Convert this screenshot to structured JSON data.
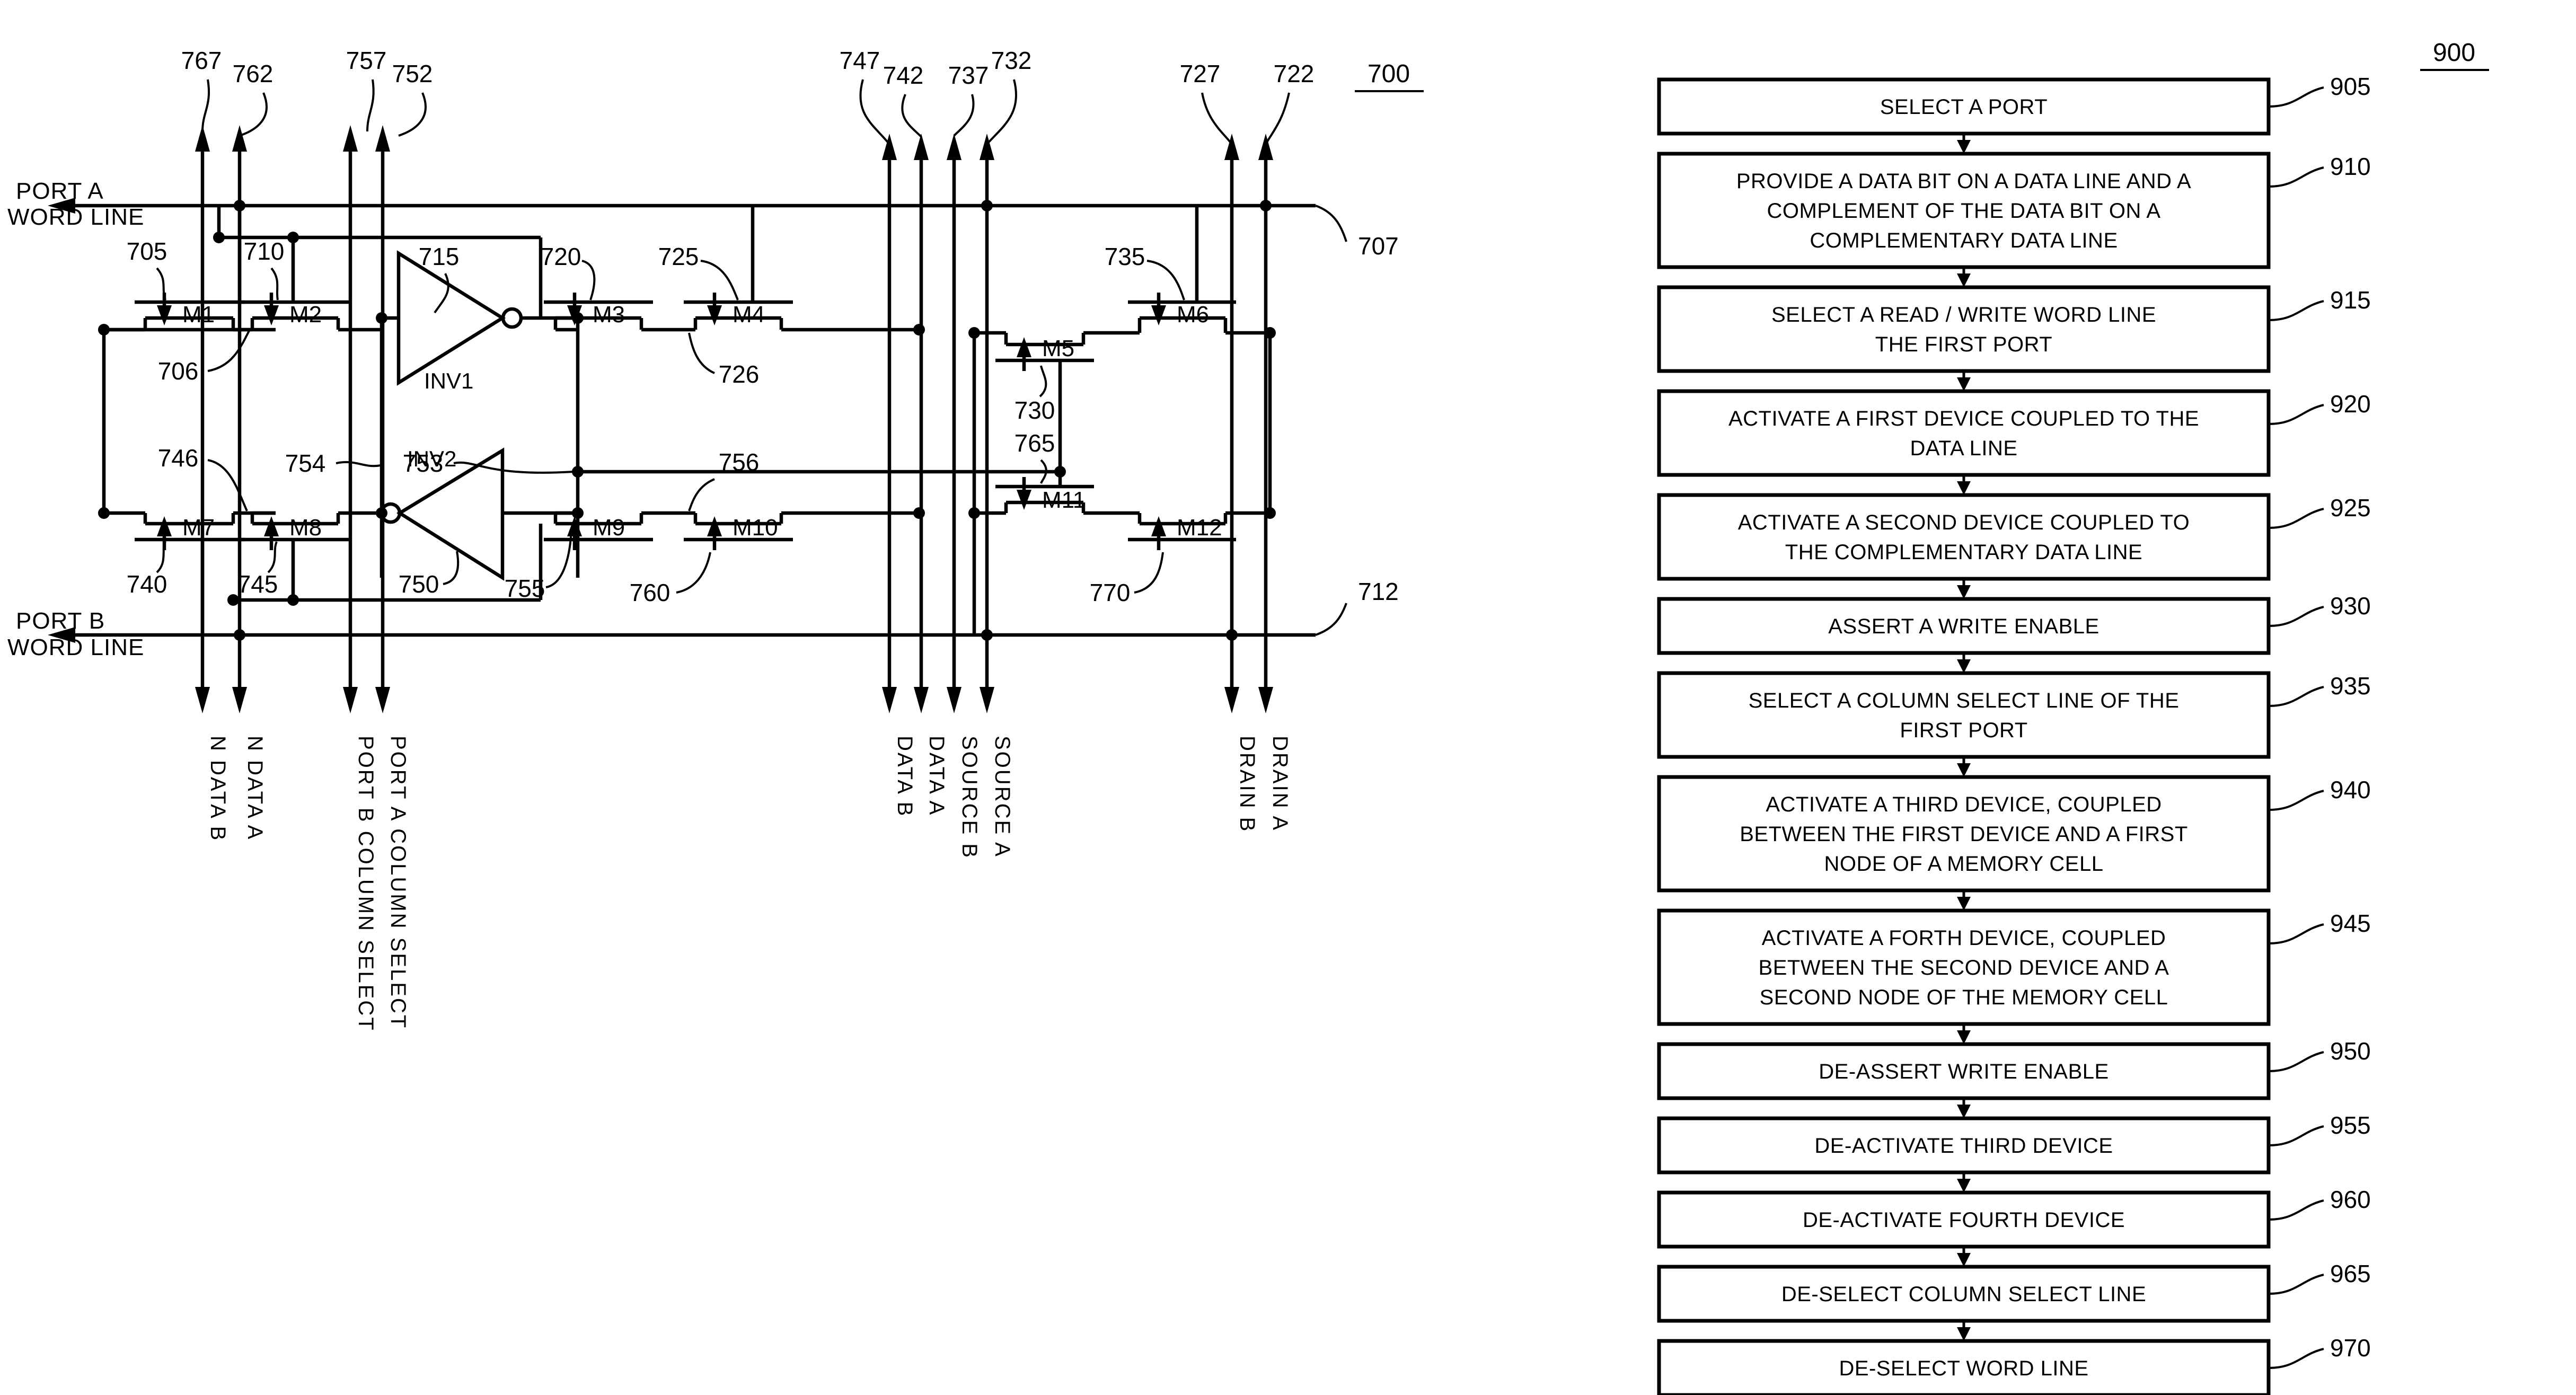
{
  "figures": {
    "circuit": {
      "fig_number": "700",
      "port_labels": {
        "port_a_word_line": "PORT A\nWORD LINE",
        "port_a_word_line_l1": "PORT A",
        "port_a_word_line_l2": "WORD LINE",
        "port_b_word_line_l1": "PORT B",
        "port_b_word_line_l2": "WORD LINE"
      },
      "transistors": [
        {
          "id": "M1",
          "label": "M1"
        },
        {
          "id": "M2",
          "label": "M2"
        },
        {
          "id": "M3",
          "label": "M3"
        },
        {
          "id": "M4",
          "label": "M4"
        },
        {
          "id": "M5",
          "label": "M5"
        },
        {
          "id": "M6",
          "label": "M6"
        },
        {
          "id": "M7",
          "label": "M7"
        },
        {
          "id": "M8",
          "label": "M8"
        },
        {
          "id": "M9",
          "label": "M9"
        },
        {
          "id": "M10",
          "label": "M10"
        },
        {
          "id": "M11",
          "label": "M11"
        },
        {
          "id": "M12",
          "label": "M12"
        }
      ],
      "inverters": [
        {
          "id": "INV1",
          "label": "INV1"
        },
        {
          "id": "INV2",
          "label": "INV2"
        }
      ],
      "reference_numerals": {
        "top": [
          "767",
          "762",
          "757",
          "752",
          "747",
          "742",
          "737",
          "732",
          "727",
          "722"
        ],
        "inner": [
          "705",
          "706",
          "710",
          "715",
          "720",
          "725",
          "726",
          "735",
          "730",
          "765",
          "753",
          "754",
          "746",
          "740",
          "745",
          "750",
          "755",
          "756",
          "760",
          "770"
        ],
        "right": [
          "707",
          "712"
        ]
      },
      "top_refs": [
        {
          "label": "767"
        },
        {
          "label": "762"
        },
        {
          "label": "757"
        },
        {
          "label": "752"
        },
        {
          "label": "747"
        },
        {
          "label": "742"
        },
        {
          "label": "737"
        },
        {
          "label": "732"
        },
        {
          "label": "727"
        },
        {
          "label": "722"
        }
      ],
      "bottom_labels": [
        {
          "text": "N DATA  B"
        },
        {
          "text": "N DATA  A"
        },
        {
          "text": "PORT B  COLUMN SELECT"
        },
        {
          "text": "PORT A  COLUMN SELECT"
        },
        {
          "text": "DATA  B"
        },
        {
          "text": "DATA  A"
        },
        {
          "text": "SOURCE  B"
        },
        {
          "text": "SOURCE  A"
        },
        {
          "text": "DRAIN  B"
        },
        {
          "text": "DRAIN  A"
        }
      ],
      "bus_refs": {
        "top_bus": "707",
        "bottom_bus": "712"
      }
    },
    "flowchart": {
      "fig_number": "900",
      "steps": [
        {
          "ref": "905",
          "text": "SELECT A PORT",
          "lines": [
            "SELECT A PORT"
          ]
        },
        {
          "ref": "910",
          "text": "PROVIDE A DATA BIT ON A DATA LINE AND A COMPLEMENT OF THE DATA BIT ON A COMPLEMENTARY DATA LINE",
          "lines": [
            "PROVIDE A DATA BIT ON A DATA LINE AND A",
            "COMPLEMENT OF THE DATA BIT ON A",
            "COMPLEMENTARY DATA LINE"
          ]
        },
        {
          "ref": "915",
          "text": "SELECT A READ / WRITE WORD LINE THE FIRST PORT",
          "lines": [
            "SELECT A READ / WRITE WORD LINE",
            "THE FIRST PORT"
          ]
        },
        {
          "ref": "920",
          "text": "ACTIVATE A FIRST DEVICE COUPLED TO THE DATA LINE",
          "lines": [
            "ACTIVATE A FIRST DEVICE COUPLED TO THE",
            "DATA LINE"
          ]
        },
        {
          "ref": "925",
          "text": "ACTIVATE A SECOND DEVICE COUPLED TO THE COMPLEMENTARY DATA LINE",
          "lines": [
            "ACTIVATE A SECOND DEVICE COUPLED TO",
            "THE COMPLEMENTARY DATA LINE"
          ]
        },
        {
          "ref": "930",
          "text": "ASSERT A WRITE ENABLE",
          "lines": [
            "ASSERT A WRITE ENABLE"
          ]
        },
        {
          "ref": "935",
          "text": "SELECT A COLUMN SELECT LINE OF THE FIRST PORT",
          "lines": [
            "SELECT A COLUMN SELECT LINE OF THE",
            "FIRST PORT"
          ]
        },
        {
          "ref": "940",
          "text": "ACTIVATE A THIRD DEVICE, COUPLED BETWEEN THE FIRST DEVICE AND A FIRST NODE OF A MEMORY CELL",
          "lines": [
            "ACTIVATE A THIRD DEVICE, COUPLED",
            "BETWEEN THE FIRST DEVICE AND A FIRST",
            "NODE OF A MEMORY CELL"
          ]
        },
        {
          "ref": "945",
          "text": "ACTIVATE A FORTH DEVICE, COUPLED BETWEEN THE SECOND DEVICE AND A SECOND NODE OF THE MEMORY CELL",
          "lines": [
            "ACTIVATE A FORTH DEVICE, COUPLED",
            "BETWEEN THE SECOND DEVICE AND A",
            "SECOND NODE OF THE MEMORY CELL"
          ]
        },
        {
          "ref": "950",
          "text": "DE-ASSERT WRITE ENABLE",
          "lines": [
            "DE-ASSERT WRITE ENABLE"
          ]
        },
        {
          "ref": "955",
          "text": "DE-ACTIVATE THIRD DEVICE",
          "lines": [
            "DE-ACTIVATE THIRD DEVICE"
          ]
        },
        {
          "ref": "960",
          "text": "DE-ACTIVATE FOURTH DEVICE",
          "lines": [
            "DE-ACTIVATE FOURTH DEVICE"
          ]
        },
        {
          "ref": "965",
          "text": "DE-SELECT COLUMN SELECT LINE",
          "lines": [
            "DE-SELECT COLUMN SELECT LINE"
          ]
        },
        {
          "ref": "970",
          "text": "DE-SELECT WORD LINE",
          "lines": [
            "DE-SELECT WORD LINE"
          ]
        }
      ]
    }
  },
  "colors": {
    "ink": "#000000",
    "paper": "#ffffff"
  }
}
